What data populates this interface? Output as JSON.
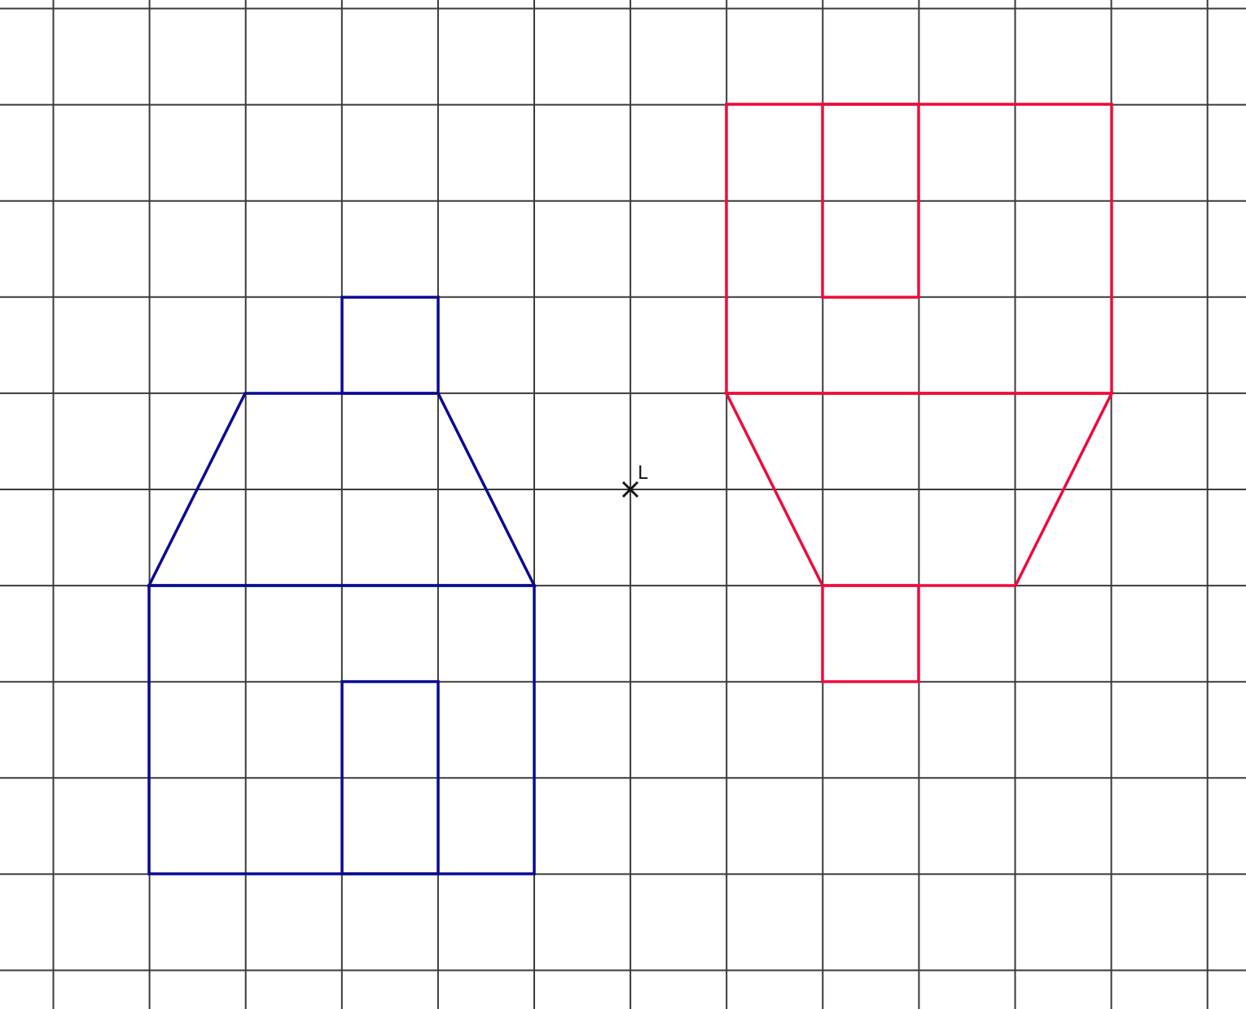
{
  "diagram": {
    "grid": {
      "visible": true,
      "color": "#3a3a3a",
      "columns": 13,
      "rows": 10
    },
    "center_point": {
      "label": "L",
      "color": "#111111"
    },
    "original_shape": {
      "color": "#0a0a96",
      "description_parts": [
        "body",
        "roof",
        "chimney",
        "door"
      ]
    },
    "image_shape": {
      "color": "#f00a3c",
      "description_parts": [
        "body",
        "roof",
        "chimney",
        "door"
      ]
    }
  }
}
